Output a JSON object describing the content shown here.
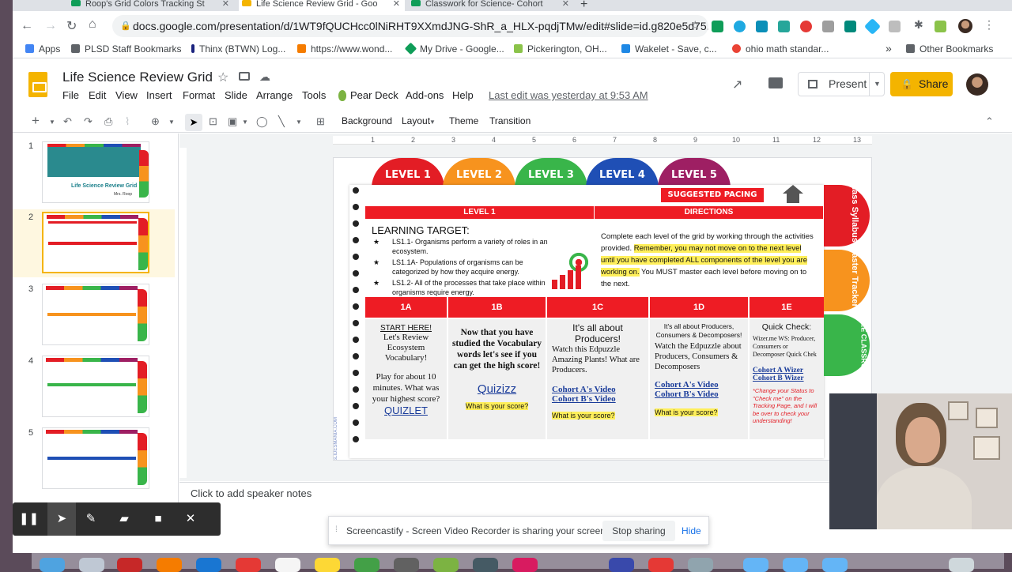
{
  "browser": {
    "tabs": [
      {
        "title": "Roop's Grid Colors Tracking St",
        "color": "#0f9d58"
      },
      {
        "title": "Life Science Review Grid - Goo",
        "color": "#f4b400",
        "active": true
      },
      {
        "title": "Classwork for Science- Cohort",
        "color": "#0f9d58"
      }
    ],
    "url": "docs.google.com/presentation/d/1WT9fQUCHcc0lNiRHT9XXmdJNG-ShR_a_HLX-pqdjTMw/edit#slide=id.g820e5d75...",
    "bookmarks": [
      {
        "label": "Apps",
        "color": "#4285f4"
      },
      {
        "label": "PLSD Staff Bookmarks",
        "color": "#5f6368"
      },
      {
        "label": "Thinx (BTWN) Log...",
        "color": "#1a237e"
      },
      {
        "label": "https://www.wond...",
        "color": "#f57c00"
      },
      {
        "label": "My Drive - Google...",
        "color": "#0f9d58"
      },
      {
        "label": "Pickerington, OH...",
        "color": "#8bc34a"
      },
      {
        "label": "Wakelet - Save, c...",
        "color": "#1e88e5"
      },
      {
        "label": "ohio math standar...",
        "color": "#ea4335"
      }
    ],
    "more_bookmarks": "»",
    "other_bookmarks": "Other Bookmarks"
  },
  "app": {
    "title": "Life Science Review Grid",
    "menu": [
      "File",
      "Edit",
      "View",
      "Insert",
      "Format",
      "Slide",
      "Arrange",
      "Tools",
      "Pear Deck",
      "Add-ons",
      "Help"
    ],
    "last_edit": "Last edit was yesterday at 9:53 AM",
    "present": "Present",
    "share": "Share"
  },
  "toolbar": {
    "background": "Background",
    "layout": "Layout",
    "theme": "Theme",
    "transition": "Transition"
  },
  "filmstrip": {
    "numbers": [
      "1",
      "2",
      "3",
      "4",
      "5"
    ],
    "thumb1_title": "Life Science Review Grid",
    "thumb1_author": "Mrs. Roop"
  },
  "ruler": [
    "1",
    "2",
    "3",
    "4",
    "5",
    "6",
    "7",
    "8",
    "9",
    "10",
    "11",
    "12",
    "13"
  ],
  "slide": {
    "levels": [
      {
        "label": "LEVEL 1",
        "color": "#e31d25"
      },
      {
        "label": "LEVEL 2",
        "color": "#f7931e"
      },
      {
        "label": "LEVEL 3",
        "color": "#39b54a"
      },
      {
        "label": "LEVEL 4",
        "color": "#1f4fb5"
      },
      {
        "label": "LEVEL 5",
        "color": "#9e1f63"
      }
    ],
    "suggested_pacing": "SUGGESTED PACING",
    "level_header": "LEVEL 1",
    "directions_header": "DIRECTIONS",
    "learning_target_title": "LEARNING TARGET:",
    "targets": [
      "LS1.1- Organisms perform a variety of roles in an ecosystem.",
      "LS1.1A- Populations of organisms can be categorized by how they acquire energy.",
      "LS1.2- All of the processes that take place within organisms require energy."
    ],
    "directions": {
      "part1": "Complete each level of the grid by working through the activities provided. ",
      "part2": "Remember, you may not move on to the next level until you have completed ALL components of the level you are working on.",
      "part3": " You MUST master each level before moving on to the next."
    },
    "side_tabs": [
      {
        "label": "Class Syllabus",
        "color": "#e31d25"
      },
      {
        "label": "Master Tracker",
        "color": "#f7931e"
      },
      {
        "label": "GOOGLE CLASSROOM",
        "color": "#39b54a"
      }
    ],
    "watermark": "SLIDESMANIA.COM",
    "columns": [
      {
        "header": "1A",
        "lines": [
          "START HERE!",
          "Let's Review",
          "Ecosystem",
          "Vocabulary!",
          "Play for about 10 minutes. What was your highest score?"
        ],
        "link": "QUIZLET"
      },
      {
        "header": "1B",
        "lines": [
          "Now that you have studied the Vocabulary words let's see if you can get the high score!"
        ],
        "link": "Quizizz",
        "score": "What is your score?"
      },
      {
        "header": "1C",
        "lines": [
          "It's all about Producers!",
          "Watch this Edpuzzle Amazing Plants! What are Producers."
        ],
        "links": [
          "Cohort A's Video",
          "Cohort B's Video"
        ],
        "score": "What is your score?"
      },
      {
        "header": "1D",
        "lines": [
          "It's all about Producers, Consumers & Decomposers!",
          "Watch the Edpuzzle about Producers, Consumers & Decomposers"
        ],
        "links": [
          "Cohort A's Video",
          "Cohort B's Video"
        ],
        "score": "What is your score?"
      },
      {
        "header": "1E",
        "lines": [
          "Quick Check:",
          "Wizer.me WS: Producer, Consumers or Decomposer Quick Chek"
        ],
        "links": [
          "Cohort A Wizer",
          "Cohort B Wizer"
        ],
        "note": "*Change your Status to \"Check me\" on the Tracking Page, and I will be over to check your understanding!"
      }
    ]
  },
  "notes": "Click to add speaker notes",
  "screencastify": {
    "message": "Screencastify - Screen Video Recorder is sharing your screen.",
    "stop": "Stop sharing",
    "hide": "Hide"
  }
}
